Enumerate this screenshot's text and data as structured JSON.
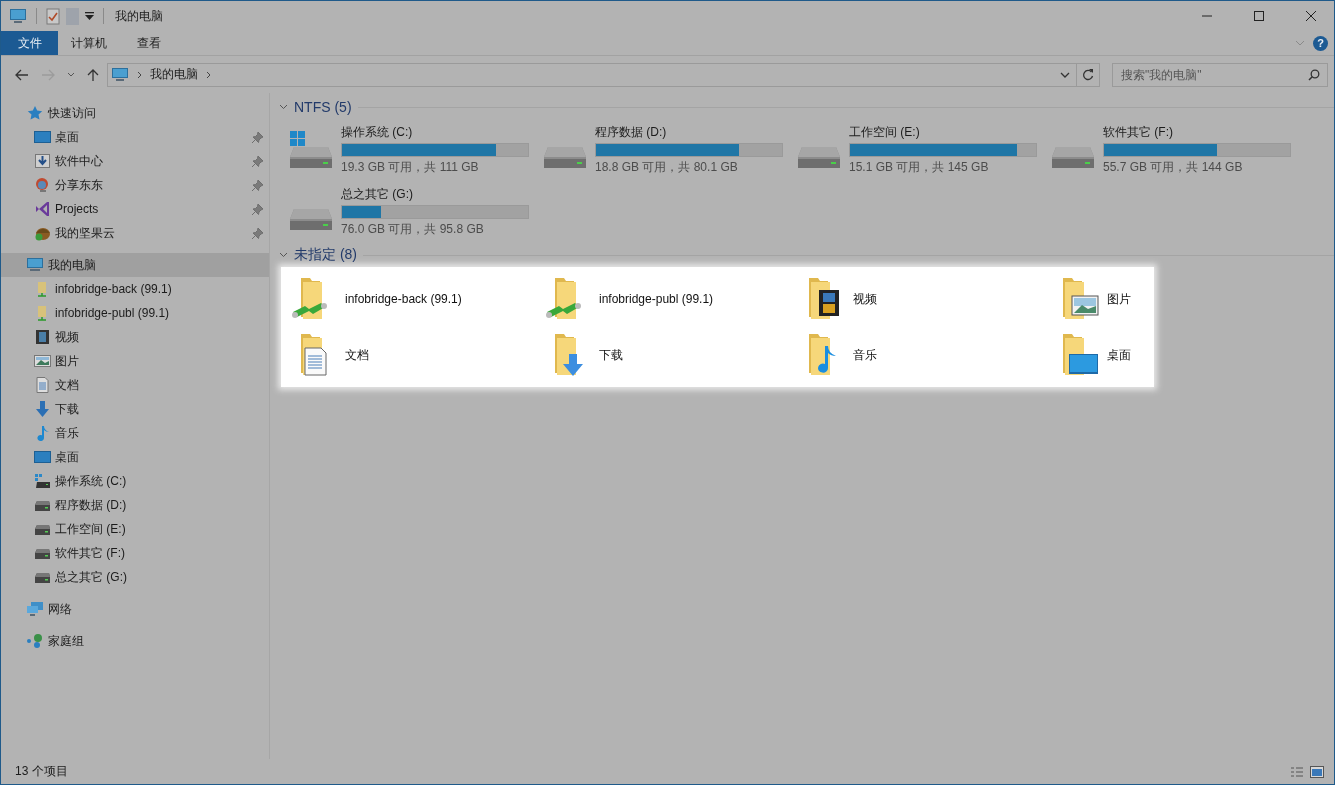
{
  "window": {
    "title": "我的电脑"
  },
  "ribbon": {
    "tabs": [
      {
        "label": "文件",
        "selected": true
      },
      {
        "label": "计算机",
        "selected": false
      },
      {
        "label": "查看",
        "selected": false
      }
    ],
    "help": "?"
  },
  "address_bar": {
    "path": [
      "我的电脑"
    ],
    "forward_disabled": true
  },
  "search": {
    "placeholder": "搜索\"我的电脑\""
  },
  "sidebar": {
    "items": [
      {
        "label": "快速访问",
        "kind": "star",
        "selected": false,
        "children": [
          {
            "label": "桌面",
            "kind": "desktop",
            "pinned": true,
            "selected": false
          },
          {
            "label": "软件中心",
            "kind": "downbox",
            "pinned": true,
            "selected": false
          },
          {
            "label": "分享东东",
            "kind": "share",
            "pinned": true,
            "selected": false
          },
          {
            "label": "Projects",
            "kind": "vs",
            "pinned": true,
            "selected": false
          },
          {
            "label": "我的坚果云",
            "kind": "nut",
            "pinned": true,
            "selected": false
          }
        ]
      },
      {
        "label": "我的电脑",
        "kind": "computer",
        "selected": true,
        "children": [
          {
            "label": "infobridge-back (99.1)",
            "kind": "netfolder",
            "pinned": false,
            "selected": false
          },
          {
            "label": "infobridge-publ (99.1)",
            "kind": "netfolder",
            "pinned": false,
            "selected": false
          },
          {
            "label": "视频",
            "kind": "video",
            "pinned": false,
            "selected": false
          },
          {
            "label": "图片",
            "kind": "picture",
            "pinned": false,
            "selected": false
          },
          {
            "label": "文档",
            "kind": "doc",
            "pinned": false,
            "selected": false
          },
          {
            "label": "下载",
            "kind": "download",
            "pinned": false,
            "selected": false
          },
          {
            "label": "音乐",
            "kind": "music",
            "pinned": false,
            "selected": false
          },
          {
            "label": "桌面",
            "kind": "desktop",
            "pinned": false,
            "selected": false
          },
          {
            "label": "操作系统 (C:)",
            "kind": "drivewin",
            "pinned": false,
            "selected": false
          },
          {
            "label": "程序数据 (D:)",
            "kind": "drive",
            "pinned": false,
            "selected": false
          },
          {
            "label": "工作空间 (E:)",
            "kind": "drive",
            "pinned": false,
            "selected": false
          },
          {
            "label": "软件其它 (F:)",
            "kind": "drive",
            "pinned": false,
            "selected": false
          },
          {
            "label": "总之其它 (G:)",
            "kind": "drive",
            "pinned": false,
            "selected": false
          }
        ]
      },
      {
        "label": "网络",
        "kind": "network",
        "selected": false
      },
      {
        "label": "家庭组",
        "kind": "homegroup",
        "selected": false
      }
    ]
  },
  "groups": [
    {
      "title": "NTFS (5)",
      "kind": "drives",
      "highlighted": false,
      "items": [
        {
          "name": "操作系统 (C:)",
          "kind": "drivewin",
          "level": 0.83,
          "reading": "19.3 GB 可用，共 111 GB"
        },
        {
          "name": "程序数据 (D:)",
          "kind": "drive",
          "level": 0.77,
          "reading": "18.8 GB 可用，共 80.1 GB"
        },
        {
          "name": "工作空间 (E:)",
          "kind": "drive",
          "level": 0.9,
          "reading": "15.1 GB 可用，共 145 GB"
        },
        {
          "name": "软件其它 (F:)",
          "kind": "drive",
          "level": 0.61,
          "reading": "55.7 GB 可用，共 144 GB"
        },
        {
          "name": "总之其它 (G:)",
          "kind": "drive",
          "level": 0.21,
          "reading": "76.0 GB 可用，共 95.8 GB"
        }
      ]
    },
    {
      "title": "未指定 (8)",
      "kind": "folders",
      "highlighted": true,
      "items": [
        {
          "name": "infobridge-back (99.1)",
          "kind": "netfolder"
        },
        {
          "name": "infobridge-publ (99.1)",
          "kind": "netfolder"
        },
        {
          "name": "视频",
          "kind": "video"
        },
        {
          "name": "图片",
          "kind": "picture"
        },
        {
          "name": "文档",
          "kind": "doc"
        },
        {
          "name": "下载",
          "kind": "download"
        },
        {
          "name": "音乐",
          "kind": "music"
        },
        {
          "name": "桌面",
          "kind": "desktop"
        }
      ]
    }
  ],
  "status_bar": {
    "text": "13 个项目"
  }
}
